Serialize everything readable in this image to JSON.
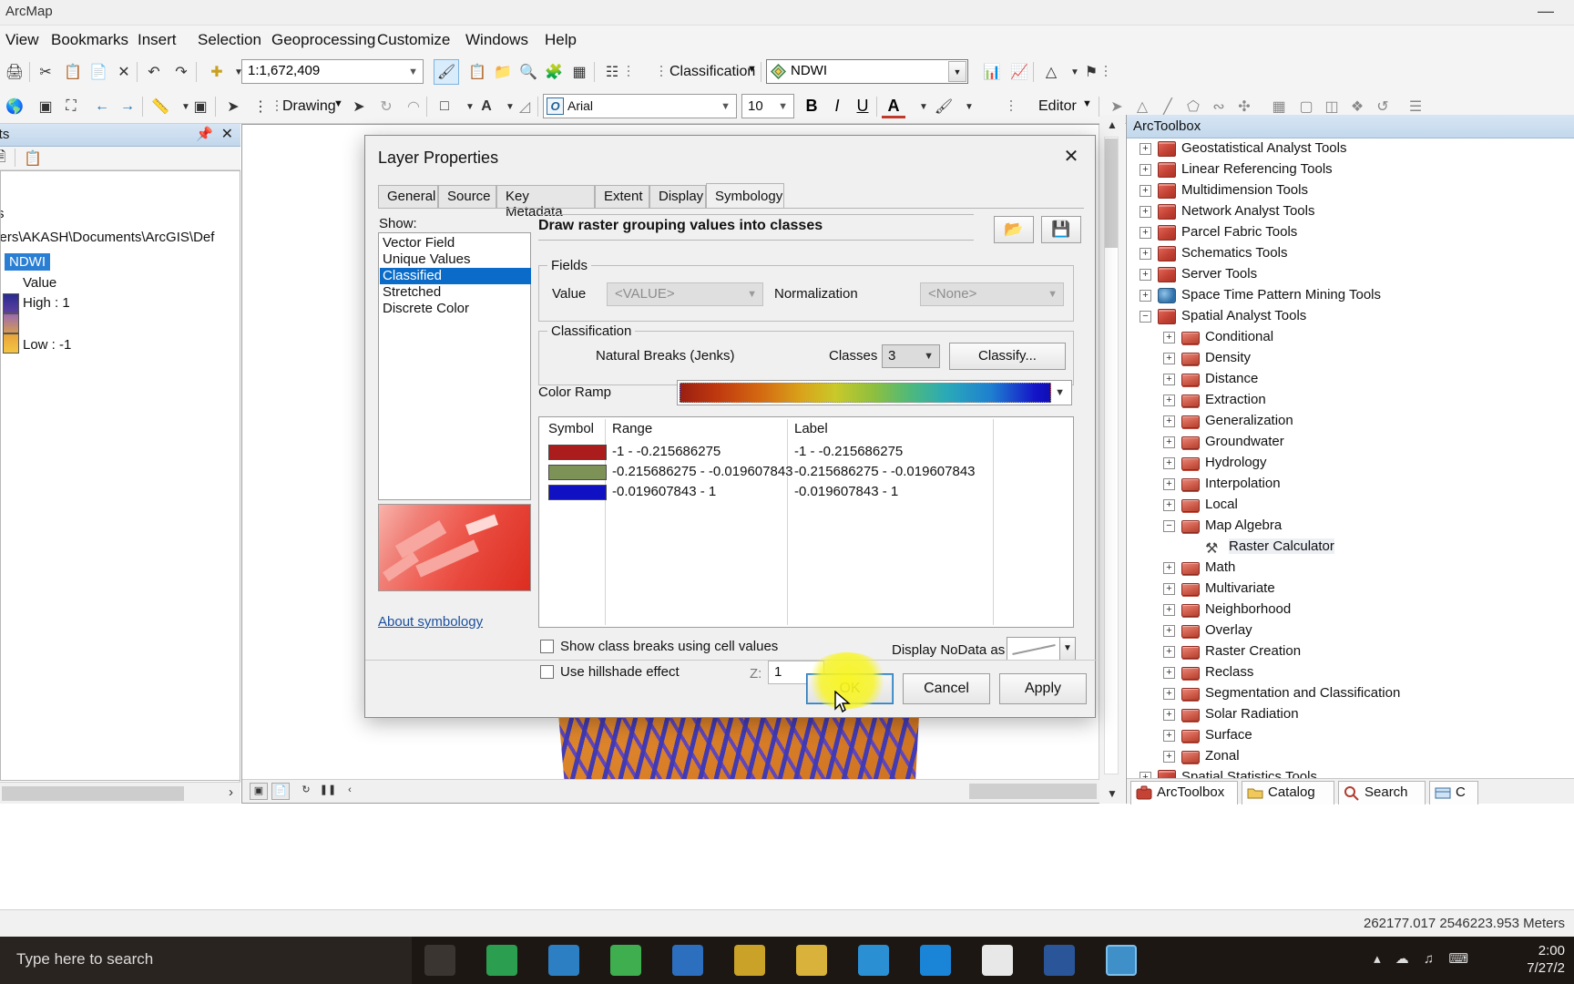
{
  "window": {
    "app_title": "ArcMap",
    "minimize": "—"
  },
  "menubar": {
    "items": [
      "View",
      "Bookmarks",
      "Insert",
      "Selection",
      "Geoprocessing",
      "Customize",
      "Windows",
      "Help"
    ]
  },
  "toolbar": {
    "scale_value": "1:1,672,409",
    "classification_label": "Classification",
    "layer_combo_value": "NDWI",
    "drawing_label": "Drawing",
    "editor_label": "Editor",
    "font_family_value": "Arial",
    "font_size_value": "10",
    "bold": "B",
    "italic": "I",
    "underline": "U",
    "font_color": "A",
    "fill_color": "⬚"
  },
  "toc": {
    "title": "ents",
    "layers_label": "s",
    "path": "\\Users\\AKASH\\Documents\\ArcGIS\\Def",
    "layer_name": "NDWI",
    "value_label": "Value",
    "high_label": "High : 1",
    "low_label": "Low : -1"
  },
  "arctoolbox": {
    "title": "ArcToolbox",
    "items": [
      {
        "label": "Geostatistical Analyst Tools",
        "level": 0,
        "icon": "toolbox-icon",
        "expander": "+"
      },
      {
        "label": "Linear Referencing Tools",
        "level": 0,
        "icon": "toolbox-icon",
        "expander": "+"
      },
      {
        "label": "Multidimension Tools",
        "level": 0,
        "icon": "toolbox-icon",
        "expander": "+"
      },
      {
        "label": "Network Analyst Tools",
        "level": 0,
        "icon": "toolbox-icon",
        "expander": "+"
      },
      {
        "label": "Parcel Fabric Tools",
        "level": 0,
        "icon": "toolbox-icon",
        "expander": "+"
      },
      {
        "label": "Schematics Tools",
        "level": 0,
        "icon": "toolbox-icon",
        "expander": "+"
      },
      {
        "label": "Server Tools",
        "level": 0,
        "icon": "toolbox-icon",
        "expander": "+"
      },
      {
        "label": "Space Time Pattern Mining Tools",
        "level": 0,
        "icon": "globe-toolbox-icon",
        "expander": "+"
      },
      {
        "label": "Spatial Analyst Tools",
        "level": 0,
        "icon": "toolbox-icon",
        "expander": "−"
      },
      {
        "label": "Conditional",
        "level": 1,
        "icon": "toolset-icon",
        "expander": "+"
      },
      {
        "label": "Density",
        "level": 1,
        "icon": "toolset-icon",
        "expander": "+"
      },
      {
        "label": "Distance",
        "level": 1,
        "icon": "toolset-icon",
        "expander": "+"
      },
      {
        "label": "Extraction",
        "level": 1,
        "icon": "toolset-icon",
        "expander": "+"
      },
      {
        "label": "Generalization",
        "level": 1,
        "icon": "toolset-icon",
        "expander": "+"
      },
      {
        "label": "Groundwater",
        "level": 1,
        "icon": "toolset-icon",
        "expander": "+"
      },
      {
        "label": "Hydrology",
        "level": 1,
        "icon": "toolset-icon",
        "expander": "+"
      },
      {
        "label": "Interpolation",
        "level": 1,
        "icon": "toolset-icon",
        "expander": "+"
      },
      {
        "label": "Local",
        "level": 1,
        "icon": "toolset-icon",
        "expander": "+"
      },
      {
        "label": "Map Algebra",
        "level": 1,
        "icon": "toolset-icon",
        "expander": "−"
      },
      {
        "label": "Raster Calculator",
        "level": 2,
        "icon": "hammer-tool-icon",
        "expander": "",
        "selected": true
      },
      {
        "label": "Math",
        "level": 1,
        "icon": "toolset-icon",
        "expander": "+"
      },
      {
        "label": "Multivariate",
        "level": 1,
        "icon": "toolset-icon",
        "expander": "+"
      },
      {
        "label": "Neighborhood",
        "level": 1,
        "icon": "toolset-icon",
        "expander": "+"
      },
      {
        "label": "Overlay",
        "level": 1,
        "icon": "toolset-icon",
        "expander": "+"
      },
      {
        "label": "Raster Creation",
        "level": 1,
        "icon": "toolset-icon",
        "expander": "+"
      },
      {
        "label": "Reclass",
        "level": 1,
        "icon": "toolset-icon",
        "expander": "+"
      },
      {
        "label": "Segmentation and Classification",
        "level": 1,
        "icon": "toolset-icon",
        "expander": "+"
      },
      {
        "label": "Solar Radiation",
        "level": 1,
        "icon": "toolset-icon",
        "expander": "+"
      },
      {
        "label": "Surface",
        "level": 1,
        "icon": "toolset-icon",
        "expander": "+"
      },
      {
        "label": "Zonal",
        "level": 1,
        "icon": "toolset-icon",
        "expander": "+"
      },
      {
        "label": "Spatial Statistics Tools",
        "level": 0,
        "icon": "toolbox-icon",
        "expander": "+"
      }
    ],
    "tabs": [
      {
        "label": "ArcToolbox",
        "icon": "toolbox-icon",
        "active": true
      },
      {
        "label": "Catalog",
        "icon": "catalog-icon",
        "active": false
      },
      {
        "label": "Search",
        "icon": "search-icon",
        "active": false
      },
      {
        "label": "C",
        "icon": "table-icon",
        "active": false
      }
    ]
  },
  "dialog": {
    "title": "Layer Properties",
    "close": "✕",
    "tabs": [
      {
        "label": "General",
        "active": false
      },
      {
        "label": "Source",
        "active": false
      },
      {
        "label": "Key Metadata",
        "active": false
      },
      {
        "label": "Extent",
        "active": false
      },
      {
        "label": "Display",
        "active": false
      },
      {
        "label": "Symbology",
        "active": true
      }
    ],
    "show_label": "Show:",
    "show_items": [
      {
        "label": "Vector Field",
        "selected": false
      },
      {
        "label": "Unique Values",
        "selected": false
      },
      {
        "label": "Classified",
        "selected": true
      },
      {
        "label": "Stretched",
        "selected": false
      },
      {
        "label": "Discrete Color",
        "selected": false
      }
    ],
    "about_symbology": "About symbology",
    "draw_title": "Draw raster grouping values into classes",
    "load_icon": "open-folder-icon",
    "save_icon": "floppy-save-icon",
    "fields_caption": "Fields",
    "value_label": "Value",
    "value_combo": "<VALUE>",
    "normalization_label": "Normalization",
    "normalization_combo": "<None>",
    "classification_caption": "Classification",
    "classification_method": "Natural Breaks (Jenks)",
    "classes_label": "Classes",
    "classes_value": "3",
    "classify_button": "Classify...",
    "color_ramp_label": "Color Ramp",
    "table": {
      "headers": [
        "Symbol",
        "Range",
        "Label"
      ],
      "rows": [
        {
          "color": "#ab1c1c",
          "range": "-1 - -0.215686275",
          "label": "-1 - -0.215686275"
        },
        {
          "color": "#7d9257",
          "range": "-0.215686275 - -0.019607843",
          "label": "-0.215686275 - -0.019607843"
        },
        {
          "color": "#1111c4",
          "range": "-0.019607843 - 1",
          "label": "-0.019607843 - 1"
        }
      ]
    },
    "show_class_breaks_label": "Show class breaks using cell values",
    "use_hillshade_label": "Use hillshade effect",
    "z_label": "Z:",
    "z_value": "1",
    "display_nodata_label": "Display NoData as",
    "ok_button": "OK",
    "cancel_button": "Cancel",
    "apply_button": "Apply"
  },
  "status": {
    "coordinates": "262177.017  2546223.953 Meters"
  },
  "taskbar": {
    "search_placeholder": "Type here to search",
    "time": "2:00",
    "date": "7/27/2"
  }
}
